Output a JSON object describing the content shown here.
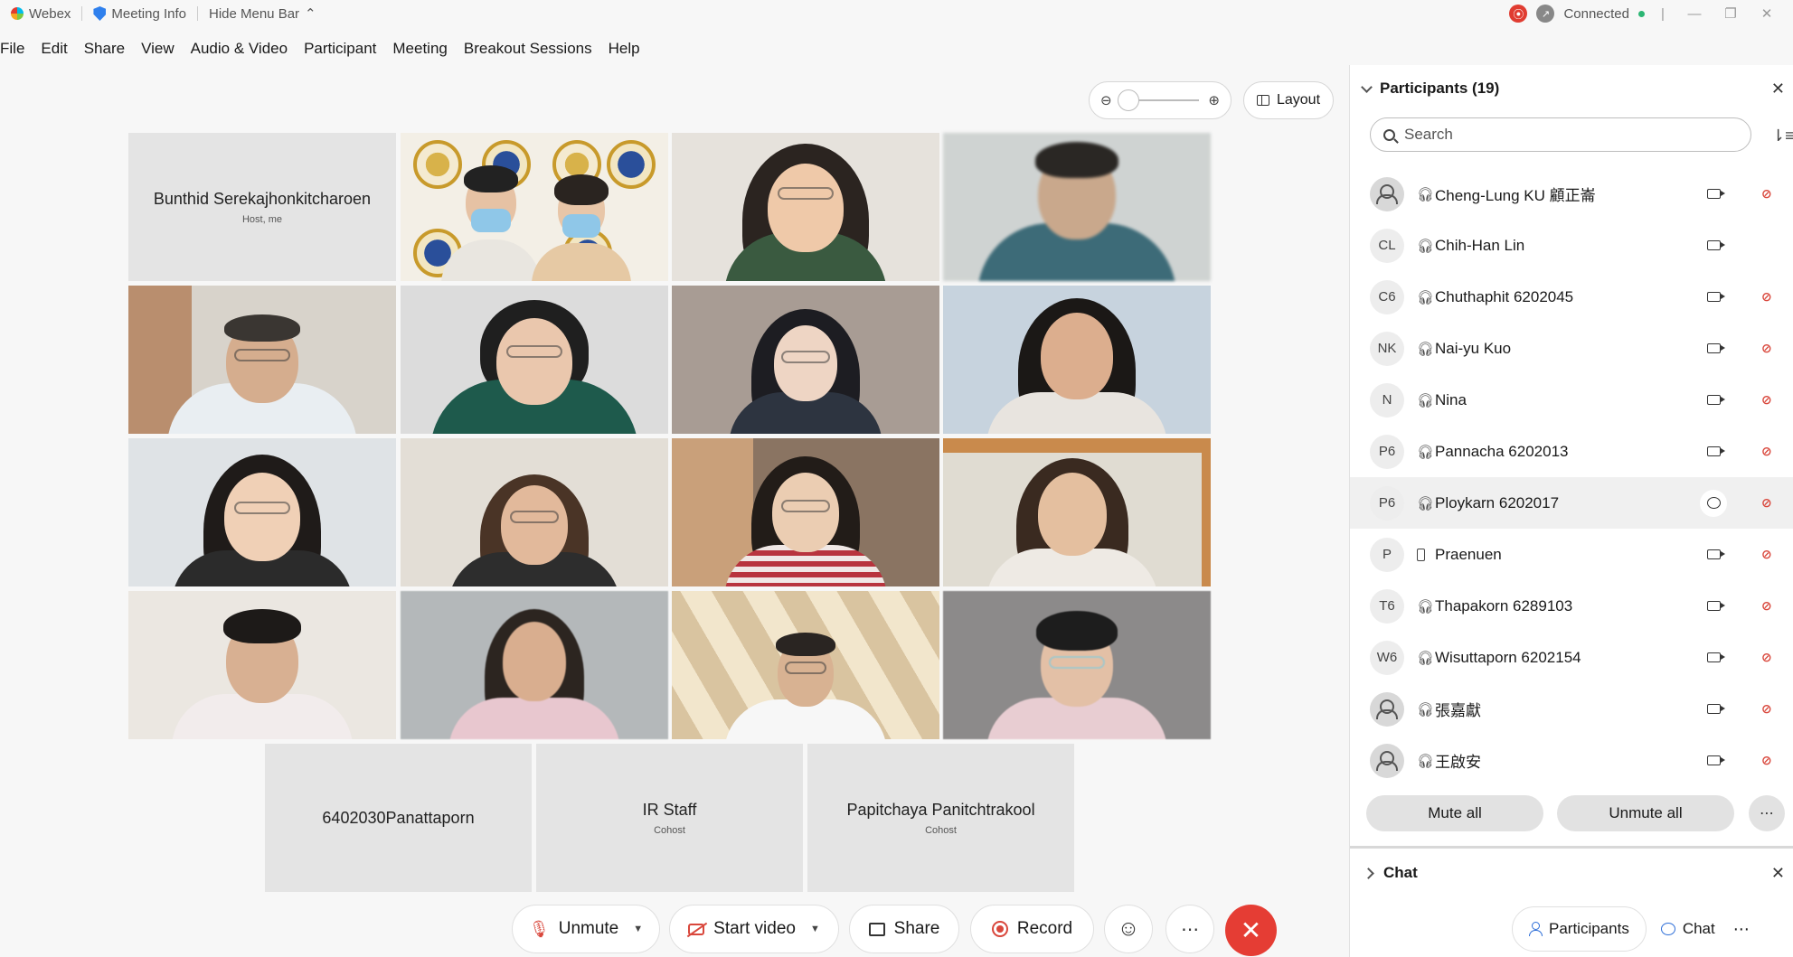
{
  "titlebar": {
    "app_name": "Webex",
    "meeting_info": "Meeting Info",
    "hide_menu": "Hide Menu Bar",
    "status": "Connected"
  },
  "menu": [
    "File",
    "Edit",
    "Share",
    "View",
    "Audio & Video",
    "Participant",
    "Meeting",
    "Breakout Sessions",
    "Help"
  ],
  "layout_label": "Layout",
  "tiles": {
    "host": {
      "name": "Bunthid Serekajhonkitcharoen",
      "role": "Host, me"
    },
    "bottom": [
      {
        "name": "6402030Panattaporn",
        "role": ""
      },
      {
        "name": "IR Staff",
        "role": "Cohost"
      },
      {
        "name": "Papitchaya Panitchtrakool",
        "role": "Cohost"
      }
    ]
  },
  "participants_panel": {
    "title": "Participants (19)",
    "search_placeholder": "Search",
    "participants": [
      {
        "initials": "",
        "name": "Cheng-Lung KU 顧正崙",
        "mic_off": true
      },
      {
        "initials": "CL",
        "name": "Chih-Han Lin",
        "mic_off": false
      },
      {
        "initials": "C6",
        "name": "Chuthaphit 6202045",
        "mic_off": true
      },
      {
        "initials": "NK",
        "name": "Nai-yu Kuo",
        "mic_off": true
      },
      {
        "initials": "N",
        "name": "Nina",
        "mic_off": true
      },
      {
        "initials": "P6",
        "name": "Pannacha 6202013",
        "mic_off": true
      },
      {
        "initials": "P6",
        "name": "Ploykarn 6202017",
        "mic_off": true
      },
      {
        "initials": "P",
        "name": "Praenuen",
        "mic_off": true
      },
      {
        "initials": "T6",
        "name": "Thapakorn 6289103",
        "mic_off": true
      },
      {
        "initials": "W6",
        "name": "Wisuttaporn 6202154",
        "mic_off": true
      },
      {
        "initials": "",
        "name": "張嘉獻",
        "mic_off": true
      },
      {
        "initials": "",
        "name": "王啟安",
        "mic_off": true
      }
    ],
    "mute_all": "Mute all",
    "unmute_all": "Unmute all"
  },
  "chat_panel": {
    "title": "Chat"
  },
  "bottom_tabs": {
    "participants": "Participants",
    "chat": "Chat"
  },
  "controls": {
    "unmute": "Unmute",
    "start_video": "Start video",
    "share": "Share",
    "record": "Record"
  },
  "colors": {
    "accent": "#2f6fd8",
    "danger": "#e53d34",
    "connected": "#2bb673"
  }
}
